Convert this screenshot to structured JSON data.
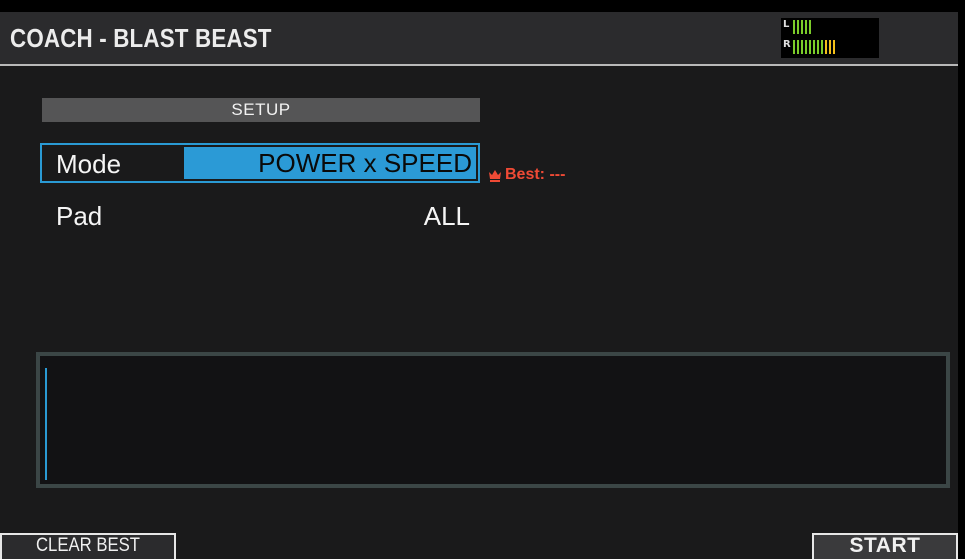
{
  "header": {
    "title": "COACH - BLAST BEAST",
    "meter": {
      "left_label": "L",
      "right_label": "R",
      "left_level": 0.28,
      "right_level": 0.62,
      "colors": {
        "low": "#7ccc2a",
        "high": "#f2c01a"
      }
    }
  },
  "setup": {
    "heading": "SETUP",
    "mode": {
      "label": "Mode",
      "value": "POWER x SPEED"
    },
    "pad": {
      "label": "Pad",
      "value": "ALL"
    },
    "best": {
      "icon": "crown-icon",
      "text": "Best: ---"
    }
  },
  "message": {
    "text": ""
  },
  "function_keys": {
    "clear_best": "CLEAR BEST",
    "start": "START"
  },
  "colors": {
    "accent": "#2b9ad6",
    "best": "#ef4a35"
  }
}
